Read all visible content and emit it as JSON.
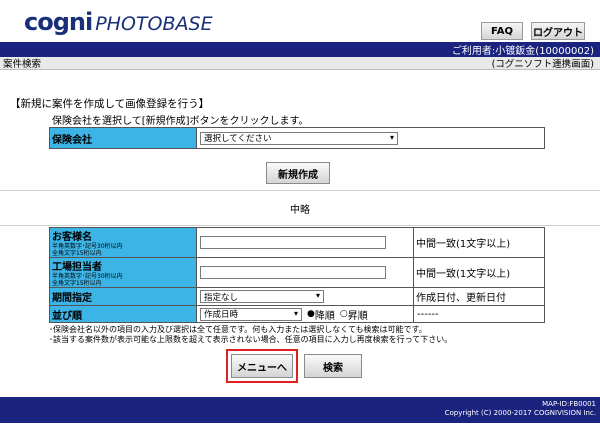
{
  "logo": {
    "part1": "cogni",
    "part2": "PHOTOBASE"
  },
  "header": {
    "faq": "FAQ",
    "logout": "ログアウト",
    "user": "ご利用者:小镀鈑金(10000002)"
  },
  "subbar": {
    "title": "案件検索",
    "note": "(コグニソフト連携画面)"
  },
  "new_case": {
    "heading": "【新規に案件を作成して画像登録を行う】",
    "instruction": "保険会社を選択して[新規作成]ボタンをクリックします。",
    "insurer_label": "保険会社",
    "insurer_select": "選択してください",
    "create_button": "新規作成"
  },
  "omitted": "中略",
  "search": {
    "customer_label": "お客様名",
    "customer_hint1": "半角英数字･記号30桁以内",
    "customer_hint2": "全角文字15桁以内",
    "customer_match": "中間一致(1文字以上)",
    "factory_label": "工場担当者",
    "factory_hint1": "半角英数字･記号30桁以内",
    "factory_hint2": "全角文字15桁以内",
    "factory_match": "中間一致(1文字以上)",
    "period_label": "期間指定",
    "period_select": "指定なし",
    "period_note": "作成日付、更新日付",
    "sort_label": "並び順",
    "sort_select": "作成日時",
    "desc": "降順",
    "asc": "昇順",
    "sort_note": "------"
  },
  "notes": {
    "line1": "･保険会社名以外の項目の入力及び選択は全て任意です。何も入力または選択しなくても検索は可能です。",
    "line2": "･該当する案件数が表示可能な上限数を超えて表示されない場合、任意の項目に入力し再度検索を行って下さい。"
  },
  "buttons": {
    "menu": "メニューへ",
    "search": "検索"
  },
  "footer": {
    "map_id": "MAP-ID:FB0001",
    "copyright": "Copyright (C) 2000-2017 COGNIVISION Inc."
  },
  "colors": {
    "navy": "#1a237e",
    "label_bg": "#3cb4e6",
    "highlight": "#e02020"
  }
}
